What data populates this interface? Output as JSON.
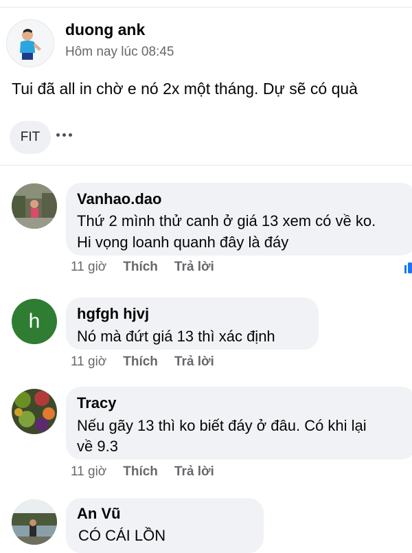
{
  "post": {
    "author": "duong ank",
    "time": "Hôm nay lúc 08:45",
    "text": "Tui đã all in chờ e nó 2x một tháng. Dự sẽ có quà",
    "tag": "FIT"
  },
  "comments": [
    {
      "author": "Vanhao.dao",
      "lines": [
        "Thứ 2 mình thử canh ở giá 13 xem có về ko.",
        "Hi vọng loanh quanh đây là đáy"
      ],
      "time": "11 giờ",
      "like_label": "Thích",
      "reply_label": "Trả lời"
    },
    {
      "author": "hgfgh hjvj",
      "avatar_letter": "h",
      "lines": [
        "Nó mà đứt giá 13 thì xác định"
      ],
      "time": "11 giờ",
      "like_label": "Thích",
      "reply_label": "Trả lời"
    },
    {
      "author": "Tracy",
      "lines": [
        "Nếu gãy 13 thì ko biết đáy ở đâu. Có khi lại",
        "về 9.3"
      ],
      "time": "11 giờ",
      "like_label": "Thích",
      "reply_label": "Trả lời"
    },
    {
      "author": "An Vũ",
      "lines": [
        "CÓ CÁI LỒN"
      ]
    }
  ],
  "colors": {
    "bubble": "#f0f2f5",
    "meta": "#65676b",
    "avatar_green": "#2e7d32",
    "reaction_blue": "#1877f2"
  }
}
